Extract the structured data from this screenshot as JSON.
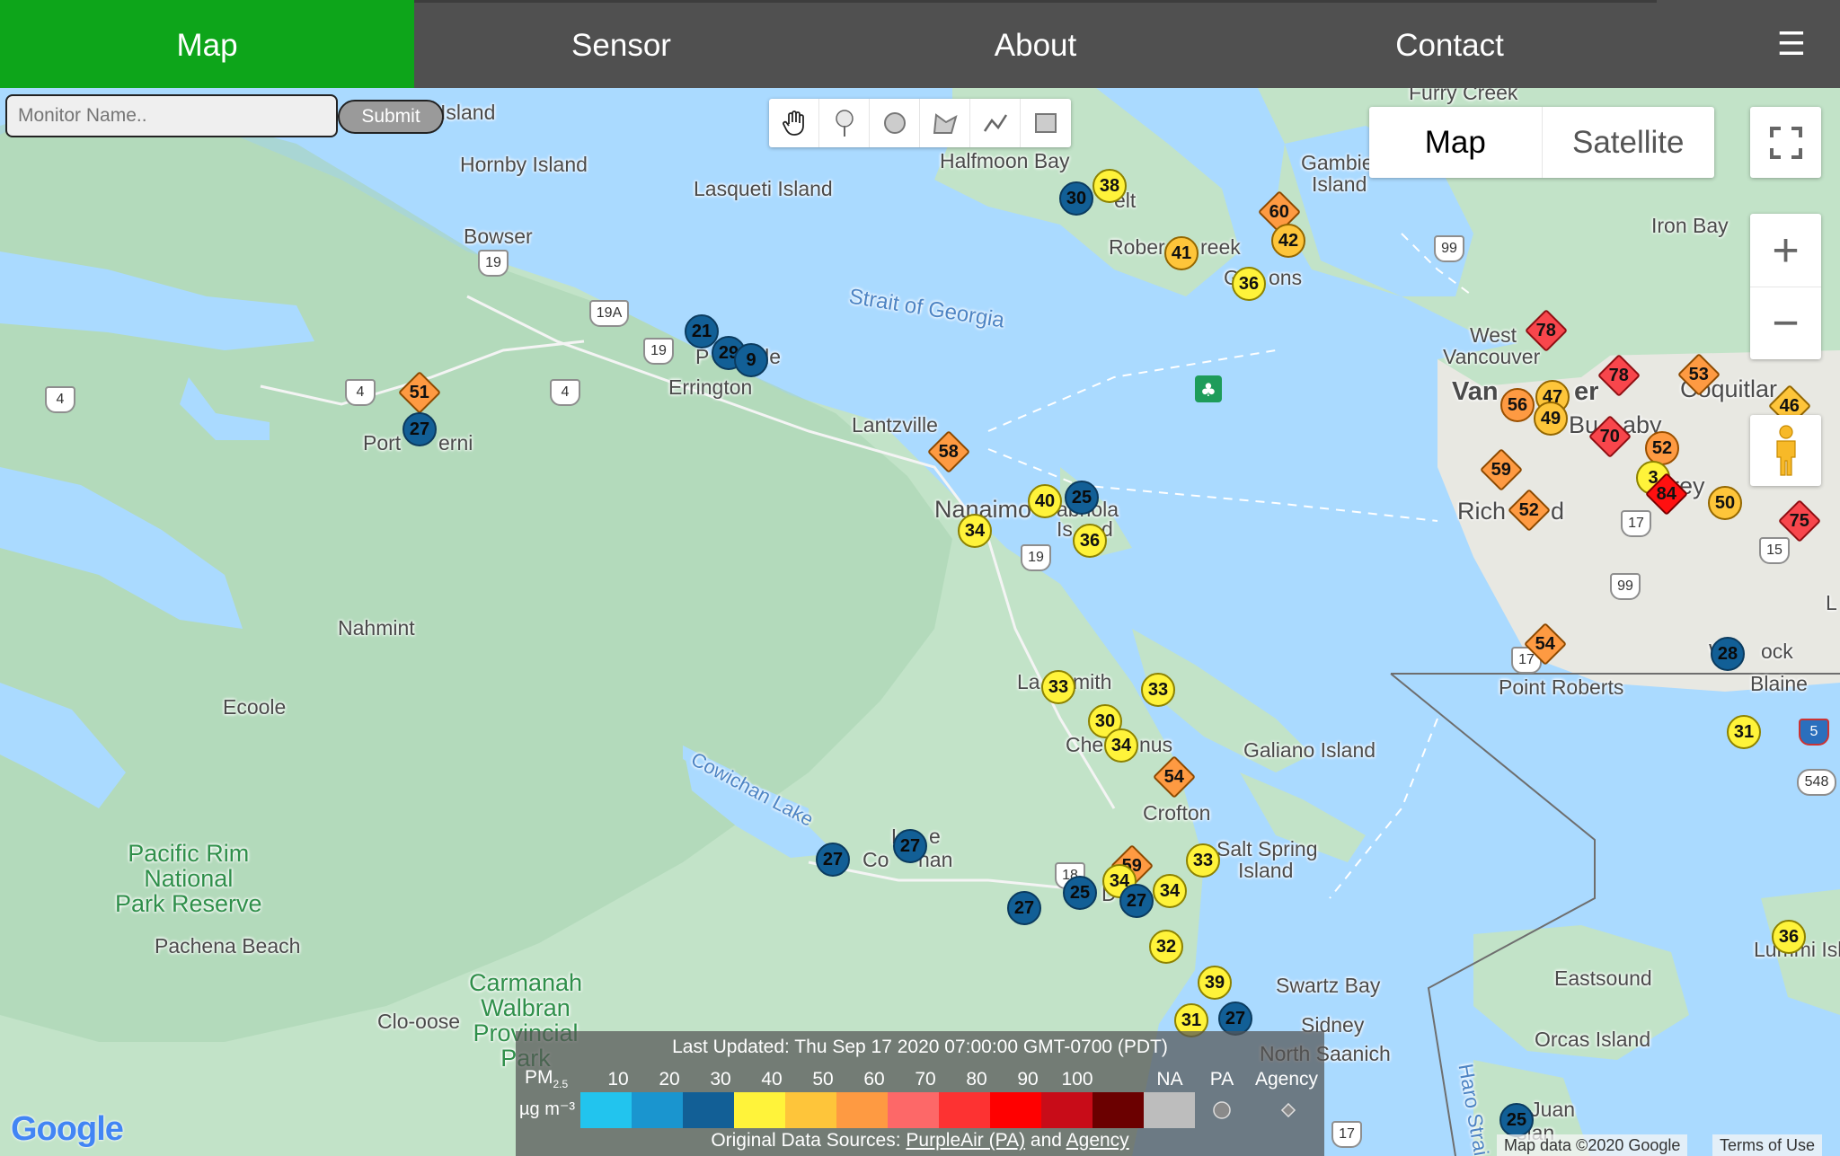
{
  "nav": {
    "items": [
      "Map",
      "Sensor",
      "About",
      "Contact"
    ],
    "menu_icon": "☰"
  },
  "search": {
    "placeholder": "Monitor Name..",
    "submit_label": "Submit"
  },
  "draw_tools": [
    "hand-icon",
    "marker-icon",
    "circle-icon",
    "polygon-icon",
    "polyline-icon",
    "rectangle-icon"
  ],
  "map_type": {
    "map_label": "Map",
    "satellite_label": "Satellite"
  },
  "zoom": {
    "in": "+",
    "out": "−"
  },
  "places": {
    "island": "Island",
    "hornby": "Hornby Island",
    "lasqueti": "Lasqueti Island",
    "halfmoon": "Halfmoon Bay",
    "furry": "Furry Creek",
    "gambier": "Gambier",
    "gambier2": "Island",
    "ironbay": "Iron Bay",
    "bowser": "Bowser",
    "sechelt_frag": "elt",
    "roberts_a": "Rober",
    "roberts_b": "reek",
    "gibsons_a": "G",
    "gibsons_b": "ons",
    "strait": "Strait of Georgia",
    "westvan1": "West",
    "westvan2": "Vancouver",
    "van1": "Van",
    "van2": "er",
    "coquitlam": "Coquitlar",
    "burnaby1": "Bu",
    "burnaby2": "aby",
    "errington": "Errington",
    "parksville1": "P",
    "parksville2": "lle",
    "portalberni1": "Port",
    "portalberni2": "erni",
    "lantzville": "Lantzville",
    "nanaimo": "Nanaimo",
    "gabriola1": "abriola",
    "gabriola2": "Is",
    "gabriola3": "d",
    "richmond1": "Rich",
    "richmond2": "d",
    "surrey": "urrey",
    "nahmint": "Nahmint",
    "ecoole": "Ecoole",
    "ladysmith1": "La",
    "ladysmith2": "mith",
    "chemainus1": "Che",
    "chemainus2": "nus",
    "galiano": "Galiano Island",
    "pointroberts": "Point Roberts",
    "white1": "Wh",
    "white2": "ock",
    "blaine": "Blaine",
    "cowichanlake": "Cowichan Lake",
    "crofton": "Crofton",
    "saltspring1": "Salt Spring",
    "saltspring2": "Island",
    "lake1": "L",
    "lake2": "e",
    "cowichan": "Co",
    "cowichan2": "han",
    "duncan": "D",
    "pacrim1": "Pacific Rim",
    "pacrim2": "National",
    "pacrim3": "Park Reserve",
    "pachena": "Pachena Beach",
    "carmanah1": "Carmanah",
    "carmanah2": "Walbran",
    "carmanah3": "Provincial",
    "carmanah4": "Park",
    "clooose": "Clo-oose",
    "swartz": "Swartz Bay",
    "sidney": "Sidney",
    "northsaanich": "North Saanich",
    "eastsound": "Eastsound",
    "orcas": "Orcas Island",
    "sanjuan1": "n Juan",
    "sanjuan2": "slan",
    "lummi": "Lummi Isla",
    "haro": "Haro Strai",
    "l": "L"
  },
  "shields": [
    "19",
    "19A",
    "19",
    "4",
    "4",
    "4",
    "99",
    "17",
    "99",
    "15",
    "17",
    "19",
    "18",
    "17",
    "5",
    "548"
  ],
  "markers": [
    {
      "v": "38",
      "c": "yellow",
      "s": "circle"
    },
    {
      "v": "30",
      "c": "blue",
      "s": "circle"
    },
    {
      "v": "60",
      "c": "orange",
      "s": "diamond"
    },
    {
      "v": "42",
      "c": "gold",
      "s": "circle"
    },
    {
      "v": "41",
      "c": "gold",
      "s": "circle"
    },
    {
      "v": "36",
      "c": "yellow",
      "s": "circle"
    },
    {
      "v": "21",
      "c": "blue",
      "s": "circle"
    },
    {
      "v": "29",
      "c": "blue",
      "s": "circle"
    },
    {
      "v": "9",
      "c": "blue",
      "s": "circle"
    },
    {
      "v": "51",
      "c": "orange",
      "s": "diamond"
    },
    {
      "v": "27",
      "c": "blue",
      "s": "circle"
    },
    {
      "v": "58",
      "c": "orange",
      "s": "diamond"
    },
    {
      "v": "40",
      "c": "yellow",
      "s": "circle"
    },
    {
      "v": "25",
      "c": "blue",
      "s": "circle"
    },
    {
      "v": "34",
      "c": "yellow",
      "s": "circle"
    },
    {
      "v": "36",
      "c": "yellow",
      "s": "circle"
    },
    {
      "v": "78",
      "c": "red",
      "s": "diamond"
    },
    {
      "v": "78",
      "c": "red",
      "s": "diamond"
    },
    {
      "v": "53",
      "c": "orange",
      "s": "diamond"
    },
    {
      "v": "56",
      "c": "orange",
      "s": "circle"
    },
    {
      "v": "47",
      "c": "gold",
      "s": "circle"
    },
    {
      "v": "49",
      "c": "gold",
      "s": "circle"
    },
    {
      "v": "46",
      "c": "gold",
      "s": "diamond"
    },
    {
      "v": "70",
      "c": "red",
      "s": "diamond"
    },
    {
      "v": "52",
      "c": "orange",
      "s": "circle"
    },
    {
      "v": "59",
      "c": "orange",
      "s": "diamond"
    },
    {
      "v": "3",
      "c": "yellow",
      "s": "circle"
    },
    {
      "v": "84",
      "c": "red2",
      "s": "diamond"
    },
    {
      "v": "52",
      "c": "orange",
      "s": "diamond"
    },
    {
      "v": "50",
      "c": "gold",
      "s": "circle"
    },
    {
      "v": "75",
      "c": "red",
      "s": "diamond"
    },
    {
      "v": "54",
      "c": "orange",
      "s": "diamond"
    },
    {
      "v": "28",
      "c": "blue",
      "s": "circle"
    },
    {
      "v": "31",
      "c": "yellow",
      "s": "circle"
    },
    {
      "v": "33",
      "c": "yellow",
      "s": "circle"
    },
    {
      "v": "33",
      "c": "yellow",
      "s": "circle"
    },
    {
      "v": "30",
      "c": "yellow",
      "s": "circle"
    },
    {
      "v": "34",
      "c": "yellow",
      "s": "circle"
    },
    {
      "v": "54",
      "c": "orange",
      "s": "diamond"
    },
    {
      "v": "27",
      "c": "blue",
      "s": "circle"
    },
    {
      "v": "27",
      "c": "blue",
      "s": "circle"
    },
    {
      "v": "59",
      "c": "orange",
      "s": "diamond"
    },
    {
      "v": "34",
      "c": "yellow",
      "s": "circle"
    },
    {
      "v": "33",
      "c": "yellow",
      "s": "circle"
    },
    {
      "v": "34",
      "c": "yellow",
      "s": "circle"
    },
    {
      "v": "25",
      "c": "blue",
      "s": "circle"
    },
    {
      "v": "27",
      "c": "blue",
      "s": "circle"
    },
    {
      "v": "27",
      "c": "blue",
      "s": "circle"
    },
    {
      "v": "32",
      "c": "yellow",
      "s": "circle"
    },
    {
      "v": "39",
      "c": "yellow",
      "s": "circle"
    },
    {
      "v": "31",
      "c": "yellow",
      "s": "circle"
    },
    {
      "v": "27",
      "c": "blue",
      "s": "circle"
    },
    {
      "v": "36",
      "c": "yellow",
      "s": "circle"
    },
    {
      "v": "25",
      "c": "blue",
      "s": "circle"
    }
  ],
  "legend": {
    "updated": "Last Updated: Thu Sep 17 2020 07:00:00 GMT-0700 (PDT)",
    "pm_label": "PM",
    "pm_sub": "2.5",
    "unit": "µg m⁻³",
    "ticks": [
      "10",
      "20",
      "30",
      "40",
      "50",
      "60",
      "70",
      "80",
      "90",
      "100"
    ],
    "na_label": "NA",
    "pa_label": "PA",
    "agency_label": "Agency",
    "colors": [
      "#22c4ee",
      "#1a95cf",
      "#125f96",
      "#fff33a",
      "#fec53a",
      "#fe9a42",
      "#fd6868",
      "#fd3232",
      "#ff0000",
      "#c80c18",
      "#6b0000",
      "#bdbdbd"
    ],
    "sources_prefix": "Original Data Sources: ",
    "purpleair": "PurpleAir (PA)",
    "and": " and ",
    "agency": "Agency"
  },
  "attribution": {
    "map_data": "Map data ©2020 Google",
    "terms": "Terms of Use"
  },
  "google_logo": "Google"
}
